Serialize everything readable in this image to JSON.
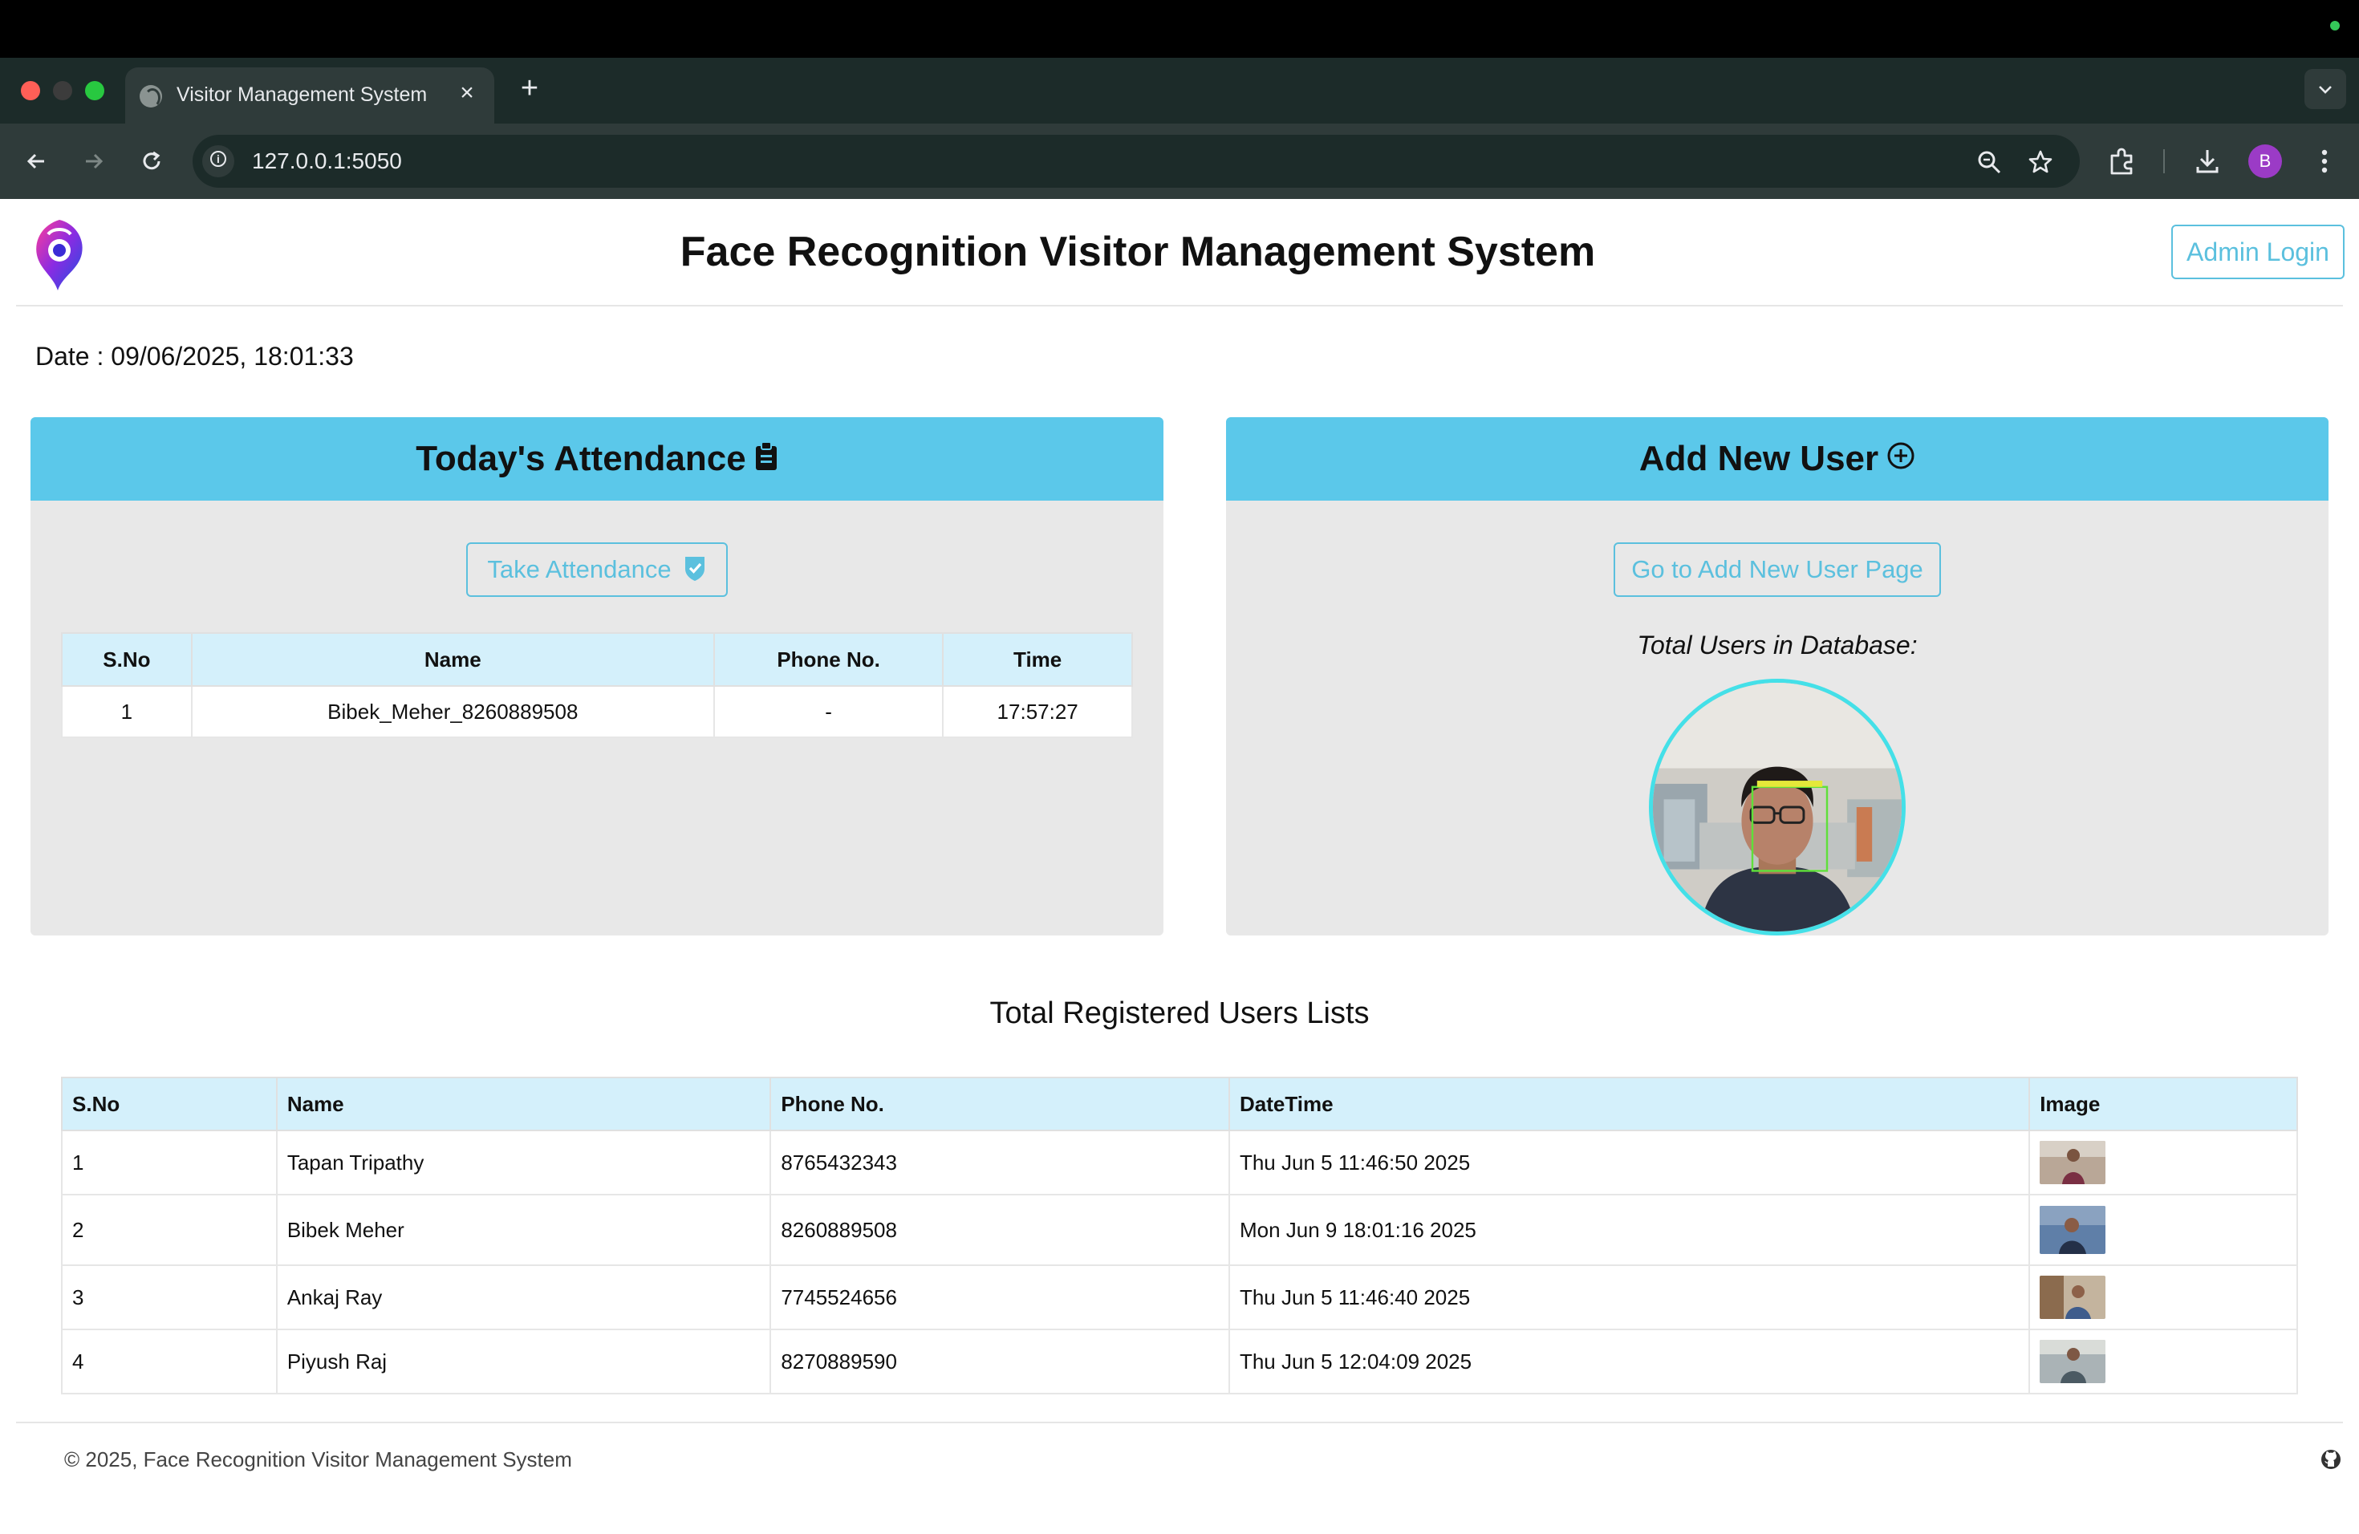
{
  "browser": {
    "tab_title": "Visitor Management System",
    "tab_close": "×",
    "new_tab": "+",
    "url": "127.0.0.1:5050",
    "avatar_initial": "B"
  },
  "header": {
    "title": "Face Recognition Visitor Management System",
    "admin_login": "Admin Login"
  },
  "date_line": "Date : 09/06/2025, 18:01:33",
  "attendance": {
    "title": "Today's Attendance",
    "button": "Take Attendance",
    "columns": [
      "S.No",
      "Name",
      "Phone No.",
      "Time"
    ],
    "rows": [
      {
        "sno": "1",
        "name": "Bibek_Meher_8260889508",
        "phone": "-",
        "time": "17:57:27"
      }
    ]
  },
  "add_user": {
    "title": "Add New User",
    "button": "Go to Add New User Page",
    "total_label": "Total Users in Database:"
  },
  "registered": {
    "title": "Total Registered Users Lists",
    "columns": [
      "S.No",
      "Name",
      "Phone No.",
      "DateTime",
      "Image"
    ],
    "rows": [
      {
        "sno": "1",
        "name": "Tapan Tripathy",
        "phone": "8765432343",
        "datetime": "Thu Jun 5 11:46:50 2025"
      },
      {
        "sno": "2",
        "name": "Bibek Meher",
        "phone": "8260889508",
        "datetime": "Mon Jun 9 18:01:16 2025"
      },
      {
        "sno": "3",
        "name": "Ankaj Ray",
        "phone": "7745524656",
        "datetime": "Thu Jun 5 11:46:40 2025"
      },
      {
        "sno": "4",
        "name": "Piyush Raj",
        "phone": "8270889590",
        "datetime": "Thu Jun 5 12:04:09 2025"
      }
    ]
  },
  "footer": {
    "text": "© 2025, Face Recognition Visitor Management System"
  },
  "colors": {
    "accent": "#5bc0de",
    "card_header": "#5bc8ea",
    "table_header": "#d4f0fb",
    "card_bg": "#e8e8e8"
  },
  "icons": [
    "globe-icon",
    "close-icon",
    "plus-icon",
    "chevron-down-icon",
    "back-arrow-icon",
    "forward-arrow-icon",
    "reload-icon",
    "info-icon",
    "zoom-icon",
    "star-icon",
    "extensions-icon",
    "download-icon",
    "more-vert-icon",
    "clipboard-icon",
    "add-circle-icon",
    "check-shield-icon",
    "github-icon"
  ]
}
